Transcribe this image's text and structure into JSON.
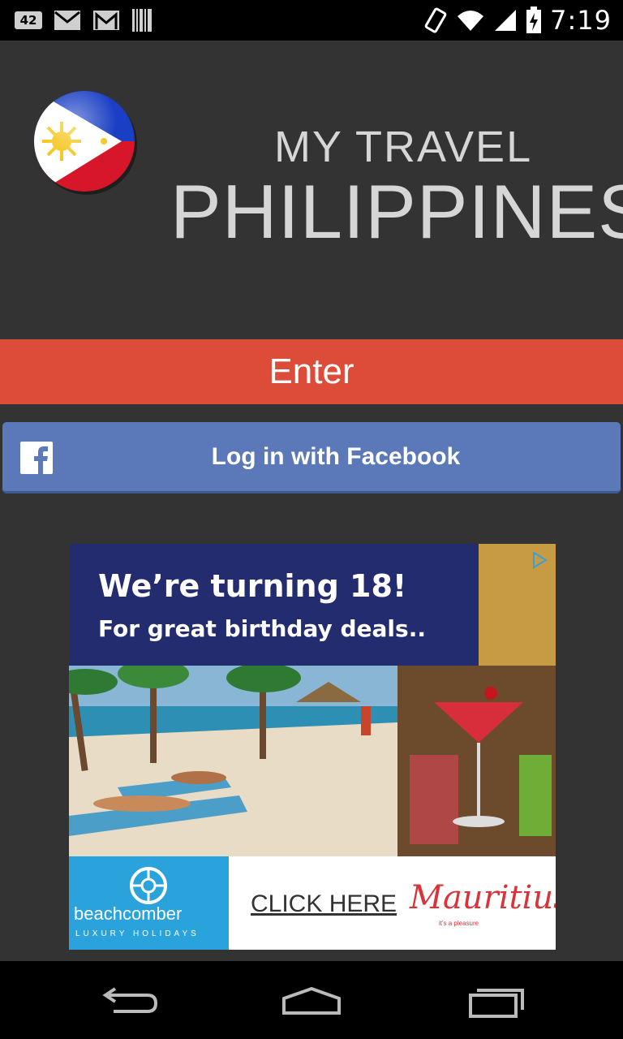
{
  "status_bar": {
    "notification_count": "42",
    "time": "7:19",
    "left_icons": [
      "notification-count-icon",
      "gmail-icon",
      "gmail-icon",
      "barcode-icon"
    ],
    "right_icons": [
      "vibrate-icon",
      "wifi-icon",
      "signal-icon",
      "battery-icon"
    ]
  },
  "header": {
    "title_line1": "MY TRAVEL",
    "title_line2": "PHILIPPINES",
    "logo_icon": "philippines-flag-icon"
  },
  "actions": {
    "enter_label": "Enter",
    "facebook_label": "Log in with Facebook",
    "facebook_icon": "facebook-icon"
  },
  "ad": {
    "headline": "We’re turning 18!",
    "subline": "For great birthday deals..",
    "brand_name": "beachcomber",
    "brand_tagline": "LUXURY HOLIDAYS",
    "cta": "CLICK HERE",
    "partner": "Mauritius",
    "partner_tagline": "it's a pleasure",
    "colors": {
      "banner": "#232c6e",
      "brand_box": "#2aa3dc",
      "partner": "#d8343a"
    }
  },
  "colors": {
    "background": "#333333",
    "enter_button": "#dd4c38",
    "facebook_button": "#5b79b8",
    "title_text": "#d6d6d6"
  },
  "nav_bar": {
    "buttons": [
      "back-icon",
      "home-icon",
      "recents-icon"
    ]
  }
}
